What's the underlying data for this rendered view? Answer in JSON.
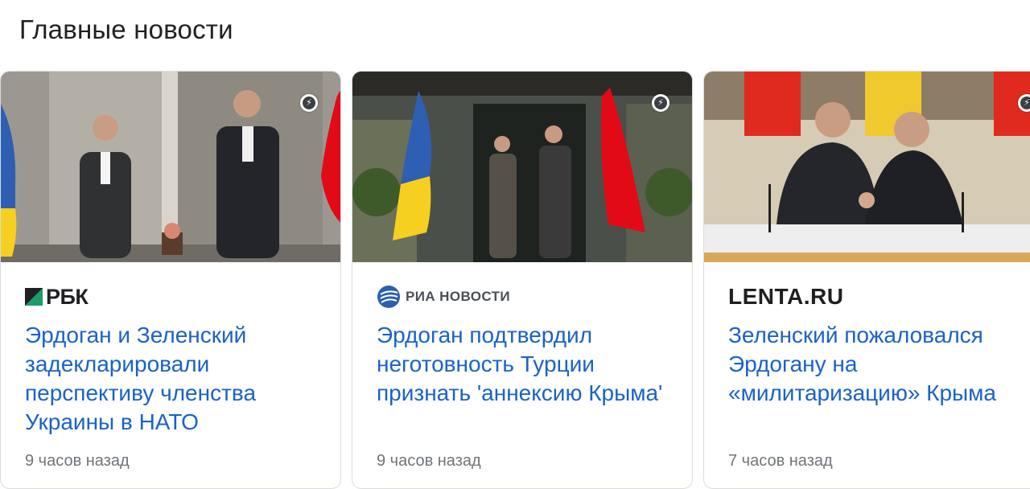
{
  "section": {
    "title": "Главные новости"
  },
  "cards": [
    {
      "source": "РБК",
      "headline": "Эрдоган и Зеленский задекларировали перспективу членства Украины в НАТО",
      "time": "9 часов назад",
      "amp_icon": "lightning-icon"
    },
    {
      "source": "РИА НОВОСТИ",
      "headline": "Эрдоган подтвердил неготовность Турции признать 'аннексию Крыма'",
      "time": "9 часов назад",
      "amp_icon": "lightning-icon"
    },
    {
      "source": "LENTA.RU",
      "headline": "Зеленский пожаловался Эрдогану на «милитаризацию» Крыма",
      "time": "7 часов назад",
      "amp_icon": "lightning-icon"
    }
  ],
  "colors": {
    "headline": "#1a62c8",
    "time": "#70757a",
    "ukraine_blue": "#2f5fb3",
    "ukraine_yellow": "#f5d020",
    "turkey_red": "#e30a17"
  }
}
